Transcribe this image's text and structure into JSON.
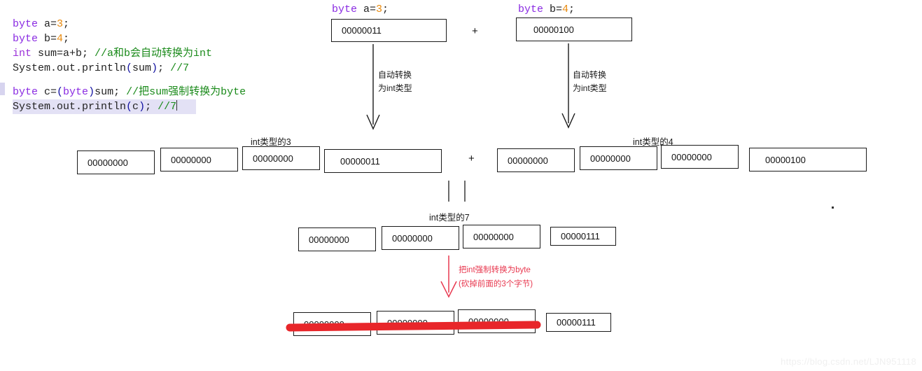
{
  "code": {
    "lines": [
      [
        {
          "t": "byte",
          "c": "kw"
        },
        {
          "t": " a=",
          "c": "plain"
        },
        {
          "t": "3",
          "c": "num"
        },
        {
          "t": ";",
          "c": "plain"
        }
      ],
      [
        {
          "t": "byte",
          "c": "kw"
        },
        {
          "t": " b=",
          "c": "plain"
        },
        {
          "t": "4",
          "c": "num"
        },
        {
          "t": ";",
          "c": "plain"
        }
      ],
      [
        {
          "t": "int",
          "c": "kw2"
        },
        {
          "t": " sum=a+b; ",
          "c": "plain"
        },
        {
          "t": "//a和b会自动转换为int",
          "c": "cmt"
        }
      ],
      [
        {
          "t": "System.out.println",
          "c": "plain"
        },
        {
          "t": "(",
          "c": "punct"
        },
        {
          "t": "sum",
          "c": "plain"
        },
        {
          "t": ")",
          "c": "punct"
        },
        {
          "t": "; ",
          "c": "plain"
        },
        {
          "t": "//7",
          "c": "cmt"
        }
      ],
      [],
      [
        {
          "t": "byte",
          "c": "kw"
        },
        {
          "t": " c=",
          "c": "plain"
        },
        {
          "t": "(",
          "c": "punct"
        },
        {
          "t": "byte",
          "c": "kw"
        },
        {
          "t": ")",
          "c": "punct"
        },
        {
          "t": "sum; ",
          "c": "plain"
        },
        {
          "t": "//把sum强制转换为byte",
          "c": "cmt"
        }
      ],
      [
        {
          "t": "System.out.println",
          "c": "plain"
        },
        {
          "t": "(",
          "c": "punct"
        },
        {
          "t": "c",
          "c": "plain"
        },
        {
          "t": ")",
          "c": "punct"
        },
        {
          "t": "; ",
          "c": "plain"
        },
        {
          "t": "//7",
          "c": "cmt"
        }
      ]
    ]
  },
  "declarations": {
    "a": {
      "kw": "byte",
      "name": " a=",
      "val": "3",
      "semi": ";"
    },
    "b": {
      "kw": "byte",
      "name": " b=",
      "val": "4",
      "semi": ";"
    }
  },
  "top_row": {
    "byte_a_value": "00000011",
    "byte_b_value": "00000100",
    "operator": "+"
  },
  "conversion_notes": {
    "left_line1": "自动转换",
    "left_line2": "为int类型",
    "right_line1": "自动转换",
    "right_line2": "为int类型"
  },
  "int_row_3": {
    "label": "int类型的3",
    "bytes": [
      "00000000",
      "00000000",
      "00000000",
      "00000011"
    ]
  },
  "int_row_4": {
    "label": "int类型的4",
    "bytes": [
      "00000000",
      "00000000",
      "00000000",
      "00000100"
    ]
  },
  "middle_operator": "+",
  "int_row_7": {
    "label": "int类型的7",
    "bytes": [
      "00000000",
      "00000000",
      "00000000",
      "00000111"
    ]
  },
  "cast_note": {
    "line1": "把int强制转换为byte",
    "line2": "(砍掉前面的3个字节)"
  },
  "byte_result_row": {
    "bytes": [
      "00000000",
      "00000000",
      "00000000",
      "00000111"
    ]
  },
  "watermark": "https://blog.csdn.net/LJN951118",
  "colors": {
    "keyword": "#8a2be2",
    "comment": "#1a8a1a",
    "number": "#e8890c",
    "punct": "#1010a0",
    "red_accent": "#e8384f",
    "strike_red": "#e8262a",
    "box_border": "#1a1a1a",
    "highlight_bg": "#e3e1f5"
  }
}
